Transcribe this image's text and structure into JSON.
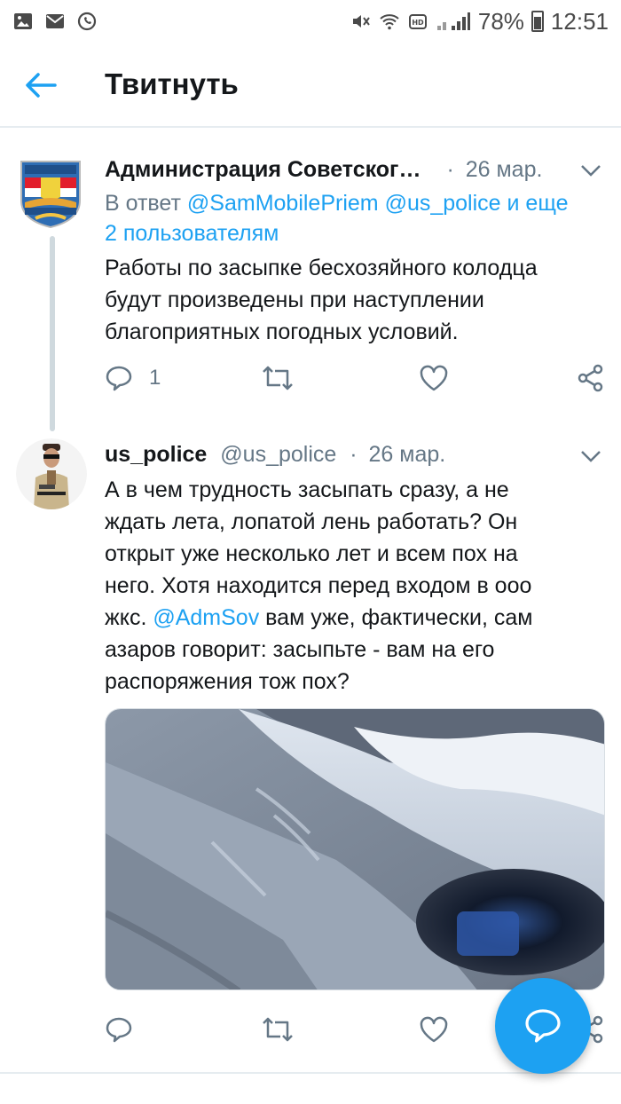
{
  "status_bar": {
    "battery": "78%",
    "time": "12:51",
    "icons": [
      "image-icon",
      "mail-icon",
      "whatsapp-icon",
      "mute-icon",
      "wifi-icon",
      "hd-icon",
      "signal-icon",
      "battery-icon"
    ]
  },
  "header": {
    "back_icon": "arrow-left-icon",
    "title": "Твитнуть"
  },
  "tweet1": {
    "name": "Администрация Советског…",
    "dot": "·",
    "date": "26 мар.",
    "reply_prefix": "В ответ",
    "reply_link": "@SamMobilePriem @us_police и еще",
    "reply_link_2": "2 пользователям",
    "text_lines": [
      "Работы по засыпке бесхозяйного колодца",
      "будут произведены при наступлении",
      "благоприятных погодных условий."
    ],
    "reply_count": "1"
  },
  "tweet2": {
    "name": "us_police",
    "handle": "@us_police",
    "dot": "·",
    "date": "26 мар.",
    "text_lines": {
      "l1": "А в чем трудность засыпать сразу, а не",
      "l2": "ждать лета, лопатой лень работать? Он",
      "l3": "открыт уже несколько лет и всем пох на",
      "l4": "него. Хотя находится перед входом в ооо",
      "l5_prefix": "жкс.",
      "l5_mention": "@AdmSov",
      "l5_suffix": "вам уже, фактически, сам",
      "l6": "азаров говорит: засыпьте - вам на его",
      "l7": "распоряжения тож пох?"
    }
  },
  "colors": {
    "accent": "#1da1f2",
    "secondary_text": "#657786",
    "divider": "#e6ecf0"
  }
}
